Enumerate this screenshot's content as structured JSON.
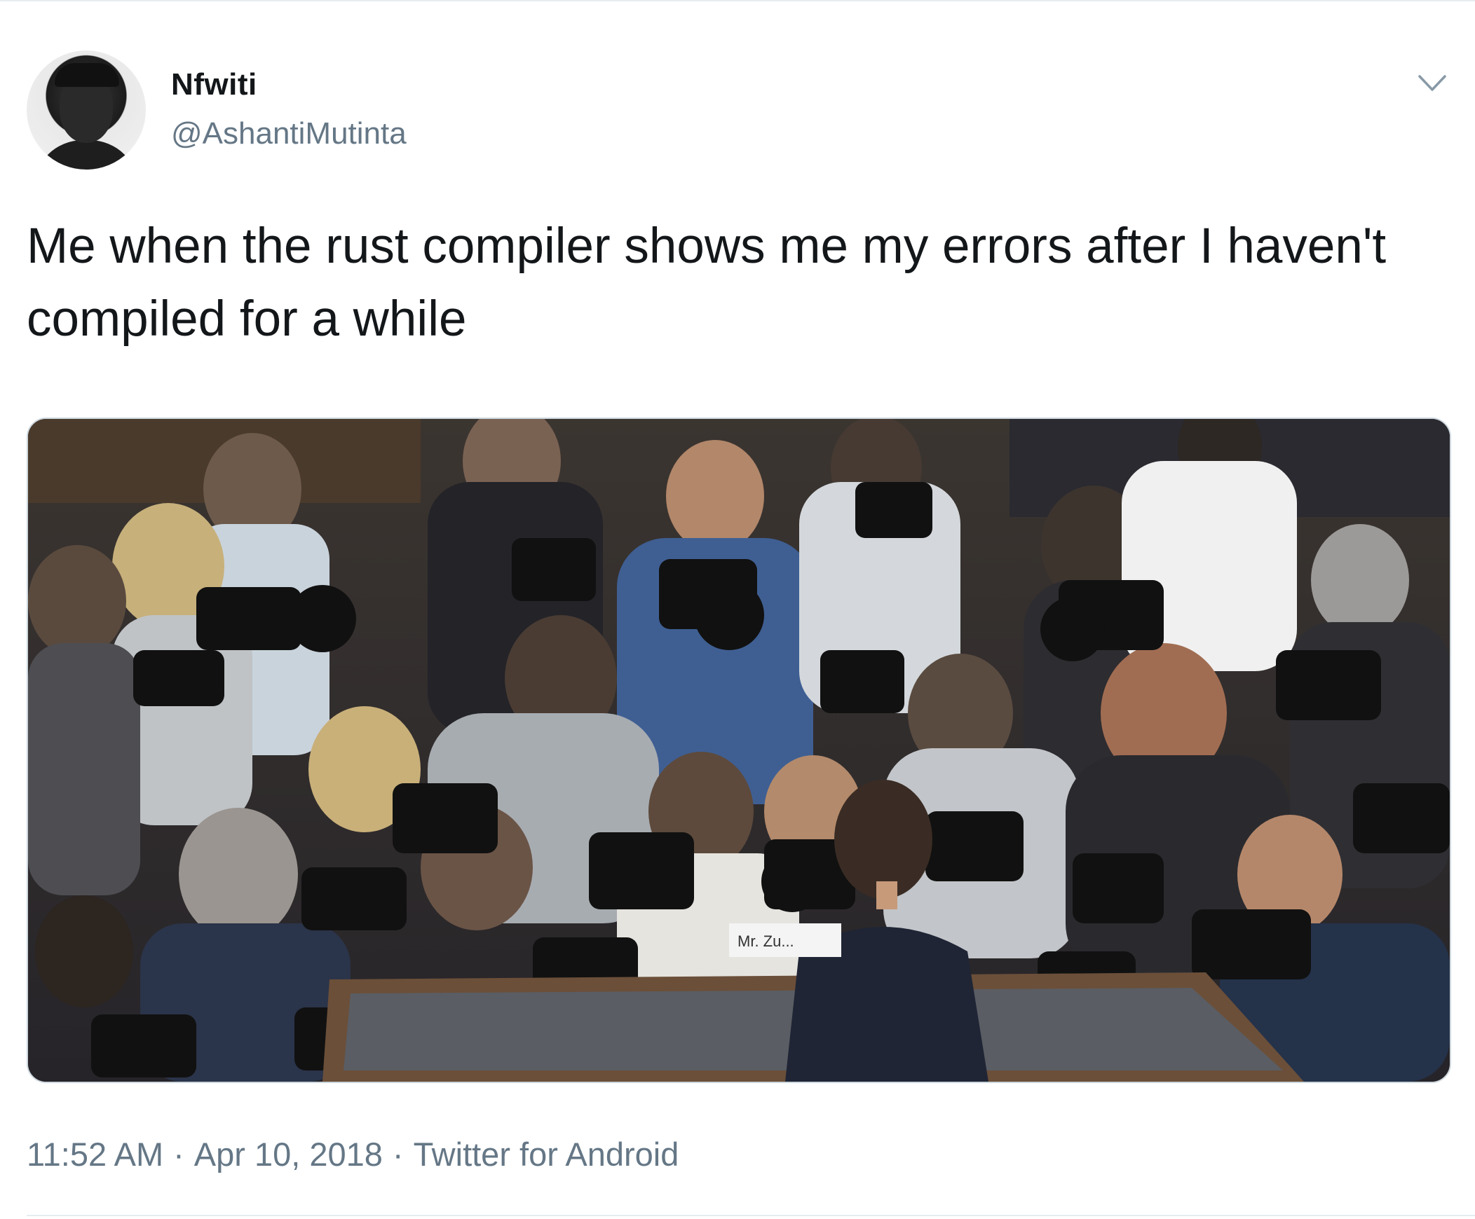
{
  "author": {
    "name": "Nfwiti",
    "handle": "@AshantiMutinta",
    "avatar_icon": "profile-avatar"
  },
  "menu": {
    "icon": "chevron-down-icon"
  },
  "tweet": {
    "text": "Me when the rust compiler shows me my errors after I haven't compiled for a while",
    "media": {
      "type": "photo",
      "placard_text": "Mr. Zu..."
    }
  },
  "meta": {
    "time": "11:52 AM",
    "separator": "·",
    "date": "Apr 10, 2018",
    "source": "Twitter for Android"
  },
  "colors": {
    "text_primary": "#14171a",
    "text_secondary": "#657786",
    "divider": "#e6ecf0",
    "media_border": "#ccd6dd"
  }
}
